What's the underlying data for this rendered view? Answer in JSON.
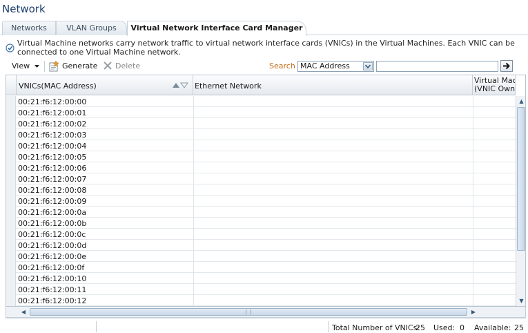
{
  "page": {
    "title": "Network"
  },
  "tabs": [
    {
      "label": "Networks"
    },
    {
      "label": "VLAN Groups"
    },
    {
      "label": "Virtual Network Interface Card Manager"
    }
  ],
  "info": {
    "text": "Virtual Machine networks carry network traffic to virtual network interface cards (VNICs) in the Virtual Machines. Each VNIC can be connected to one Virtual Machine network."
  },
  "toolbar": {
    "view_label": "View",
    "generate_label": "Generate",
    "delete_label": "Delete",
    "search_label": "Search",
    "search_field": "MAC Address",
    "search_value": ""
  },
  "table": {
    "columns": [
      {
        "label": "VNICs(MAC Address)"
      },
      {
        "label": "Ethernet Network"
      },
      {
        "label": "Virtual Mach",
        "label2": "(VNIC Owne"
      }
    ],
    "rows": [
      "00:21:f6:12:00:00",
      "00:21:f6:12:00:01",
      "00:21:f6:12:00:02",
      "00:21:f6:12:00:03",
      "00:21:f6:12:00:04",
      "00:21:f6:12:00:05",
      "00:21:f6:12:00:06",
      "00:21:f6:12:00:07",
      "00:21:f6:12:00:08",
      "00:21:f6:12:00:09",
      "00:21:f6:12:00:0a",
      "00:21:f6:12:00:0b",
      "00:21:f6:12:00:0c",
      "00:21:f6:12:00:0d",
      "00:21:f6:12:00:0e",
      "00:21:f6:12:00:0f",
      "00:21:f6:12:00:10",
      "00:21:f6:12:00:11",
      "00:21:f6:12:00:12"
    ]
  },
  "status": {
    "total_label": "Total Number of VNICs:",
    "total_value": "25",
    "used_label": "Used:",
    "used_value": "0",
    "available_label": "Available:",
    "available_value": "25"
  },
  "colors": {
    "title": "#1c3e6e",
    "search_label": "#c46a12"
  },
  "icons": [
    "info-check-icon",
    "generate-icon",
    "delete-icon",
    "dropdown-arrow-icon",
    "go-arrow-icon",
    "sort-icon"
  ]
}
